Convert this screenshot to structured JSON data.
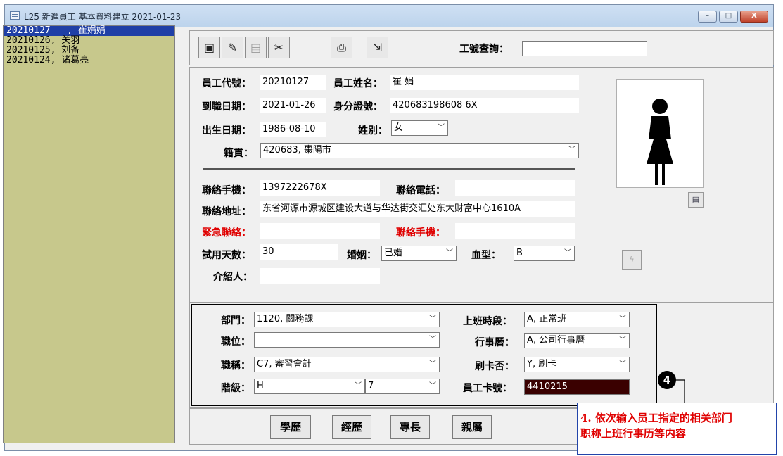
{
  "window": {
    "title": "L25 新進員工 基本資料建立  2021-01-23",
    "min": "–",
    "max": "□",
    "close": "X"
  },
  "employee_list": [
    {
      "label": "20210127   , 崔娟娟",
      "selected": true
    },
    {
      "label": "20210126, 关羽",
      "selected": false
    },
    {
      "label": "20210125, 刘备",
      "selected": false
    },
    {
      "label": "20210124, 诸葛亮",
      "selected": false
    }
  ],
  "toolbar": {
    "icons": [
      "add-record-icon",
      "edit-record-icon",
      "delete-record-icon",
      "cut-icon",
      "print-icon",
      "exit-icon"
    ],
    "glyphs": [
      "▣",
      "✎",
      "▤",
      "✂",
      "⎙",
      "⇲"
    ],
    "search_label": "工號查詢：",
    "search_value": ""
  },
  "basic": {
    "emp_id_label": "員工代號：",
    "emp_id": "20210127",
    "emp_name_label": "員工姓名：",
    "emp_name": "崔       娟",
    "hire_date_label": "到職日期：",
    "hire_date": "2021-01-26",
    "id_no_label": "身分證號：",
    "id_no": "420683198608   6X",
    "birth_label": "出生日期：",
    "birth": "1986-08-10",
    "gender_label": "姓別：",
    "gender": "女",
    "native_label": "籍貫：",
    "native": "420683, 棗陽市"
  },
  "contact": {
    "mobile_label": "聯絡手機：",
    "mobile": "1397222678X",
    "phone_label": "聯絡電話：",
    "phone": "",
    "address_label": "聯絡地址：",
    "address": "东省河源市源城区建设大道与华达街交汇处东大财富中心1610A",
    "emergency_label": "緊急聯絡：",
    "emergency": "",
    "emergency_mobile_label": "聯絡手機：",
    "emergency_mobile": "",
    "trial_label": "試用天數：",
    "trial": "30",
    "marriage_label": "婚姻：",
    "marriage": "已婚",
    "blood_label": "血型：",
    "blood": "B",
    "referrer_label": "介紹人：",
    "referrer": ""
  },
  "dept": {
    "dept_label": "部門：",
    "dept": "1120, 關務課",
    "position_label": "職位：",
    "position": "",
    "title_label": "職稱：",
    "title": "C7, 審習會計",
    "grade_label": "階級：",
    "grade": "H",
    "grade2": "7",
    "shift_label": "上班時段：",
    "shift": "A, 正常班",
    "calendar_label": "行事曆：",
    "calendar": "A, 公司行事曆",
    "punch_label": "刷卡否：",
    "punch": "Y, 刷卡",
    "card_label": "員工卡號：",
    "card": "4410215"
  },
  "bottom_buttons": [
    "學歷",
    "經歷",
    "專長",
    "親屬"
  ],
  "annotation": {
    "badge": "4",
    "line1": "4. 依次输入员工指定的相关部门",
    "line2": "职称上班行事历等内容"
  }
}
